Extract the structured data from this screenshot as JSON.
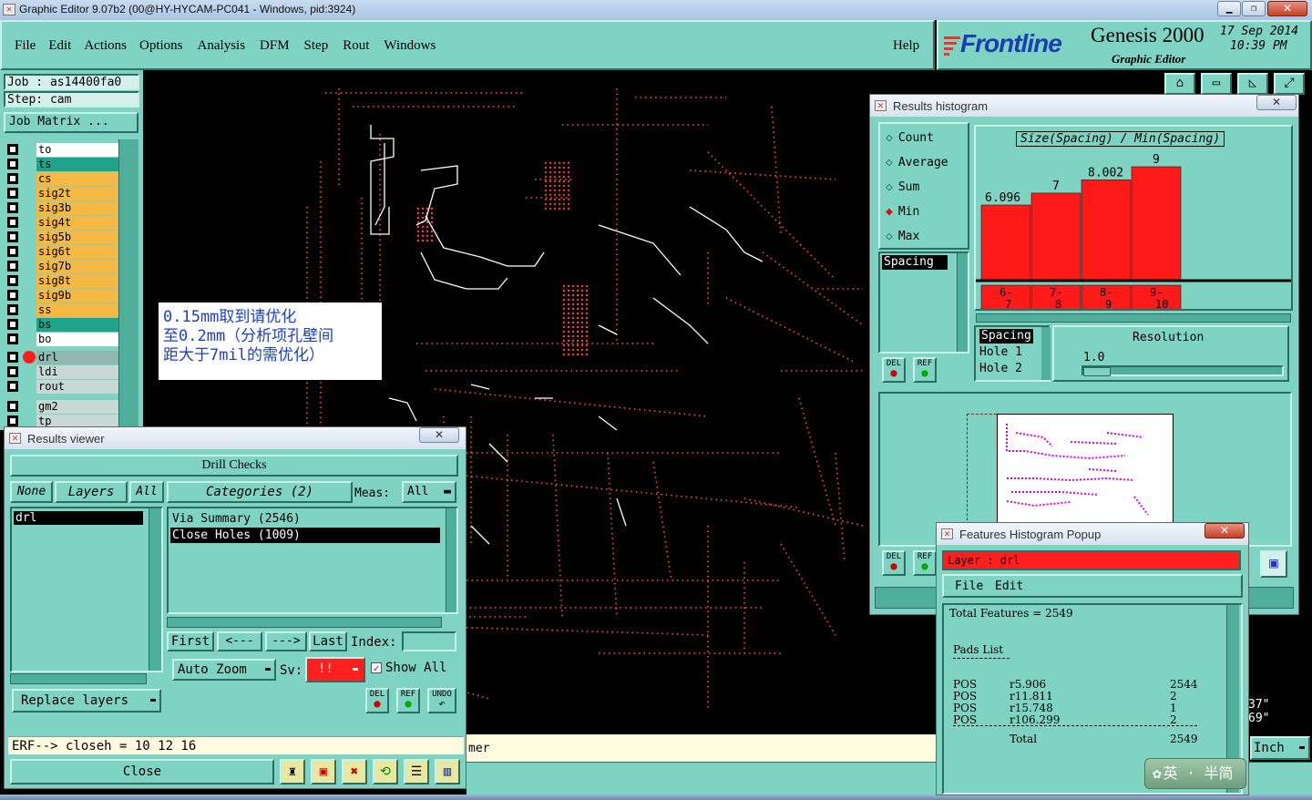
{
  "window": {
    "title": "Graphic Editor 9.07b2 (00@HY-HYCAM-PC041 - Windows, pid:3924)"
  },
  "menu": {
    "items": [
      "File",
      "Edit",
      "Actions",
      "Options",
      "Analysis",
      "DFM",
      "Step",
      "Rout",
      "Windows"
    ],
    "help": "Help"
  },
  "brand": {
    "logo": "Frontline",
    "product": "Genesis 2000",
    "subtitle": "Graphic Editor",
    "date": "17 Sep 2014",
    "time": "10:39 PM"
  },
  "job": {
    "job_label": "Job : as14400fa0",
    "step_label": "Step: cam",
    "matrix_button": "Job Matrix ..."
  },
  "layers": [
    {
      "name": "to",
      "bg": "#ffffff"
    },
    {
      "name": "ts",
      "bg": "#1fa38a"
    },
    {
      "name": "cs",
      "bg": "#f5b843"
    },
    {
      "name": "sig2t",
      "bg": "#f5b843"
    },
    {
      "name": "sig3b",
      "bg": "#f5b843"
    },
    {
      "name": "sig4t",
      "bg": "#f5b843"
    },
    {
      "name": "sig5b",
      "bg": "#f5b843"
    },
    {
      "name": "sig6t",
      "bg": "#f5b843"
    },
    {
      "name": "sig7b",
      "bg": "#f5b843"
    },
    {
      "name": "sig8t",
      "bg": "#f5b843"
    },
    {
      "name": "sig9b",
      "bg": "#f5b843"
    },
    {
      "name": "ss",
      "bg": "#f5b843"
    },
    {
      "name": "bs",
      "bg": "#1fa38a"
    },
    {
      "name": "bo",
      "bg": "#ffffff"
    }
  ],
  "layers2": [
    {
      "name": "drl",
      "bg": "#8fb8b0"
    },
    {
      "name": "ldi",
      "bg": "#c8d8d4"
    },
    {
      "name": "rout",
      "bg": "#c8d8d4"
    }
  ],
  "layers3": [
    {
      "name": "gm2",
      "bg": "#c8d8d4"
    },
    {
      "name": "tp",
      "bg": "#c8d8d4"
    }
  ],
  "note": {
    "line1": "0.15mm取到请优化",
    "line2": "至0.2mm（分析项孔壁间",
    "line3": "距大于7mil的需优化）"
  },
  "results_viewer": {
    "title": "Results viewer",
    "header": "Drill Checks",
    "none": "None",
    "layers": "Layers",
    "all": "All",
    "categories": "Categories (2)",
    "meas_label": "Meas:",
    "meas_value": "All",
    "layer_items": [
      "drl"
    ],
    "categories_list": [
      "Via Summary (2546)",
      "Close Holes (1009)"
    ],
    "nav": {
      "first": "First",
      "prev": "<---",
      "next": "--->",
      "last": "Last",
      "index_label": "Index:"
    },
    "auto_zoom": "Auto Zoom",
    "sv_label": "Sv:",
    "sv_value": "!!",
    "show_all": "Show All",
    "replace_layers": "Replace layers",
    "del": "DEL",
    "ref": "REF",
    "undo": "UNDO",
    "erf": "ERF--> closeh = 10 12 16",
    "close": "Close"
  },
  "histogram": {
    "title": "Results histogram",
    "modes": [
      "Count",
      "Average",
      "Sum",
      "Min",
      "Max"
    ],
    "selected_mode": "Min",
    "list_items": [
      "Spacing"
    ],
    "chart_title": "Size(Spacing) / Min(Spacing)",
    "param_items": [
      "Spacing",
      "Hole 1",
      "Hole 2"
    ],
    "resolution_label": "Resolution",
    "resolution_value": "1.0",
    "del": "DEL",
    "ref": "REF"
  },
  "chart_data": {
    "type": "bar",
    "title": "Size(Spacing) / Min(Spacing)",
    "categories": [
      "6-7",
      "7-8",
      "8-9",
      "9-10"
    ],
    "category_top": [
      "6-",
      "7-",
      "8-",
      "9-"
    ],
    "category_bottom": [
      "7",
      "8",
      "9",
      "10"
    ],
    "values": [
      6.096,
      7,
      8.002,
      9
    ],
    "value_labels": [
      "6.096",
      "7",
      "8.002",
      "9"
    ],
    "color": "#ff1a1a"
  },
  "features_popup": {
    "title": "Features Histogram Popup",
    "layer_label": "Layer : drl",
    "menu": [
      "File",
      "Edit"
    ],
    "total": "Total Features = 2549",
    "pads_header": "Pads List",
    "rows": [
      {
        "pol": "POS",
        "sym": "r5.906",
        "count": "2544"
      },
      {
        "pol": "POS",
        "sym": "r11.811",
        "count": "2"
      },
      {
        "pol": "POS",
        "sym": "r15.748",
        "count": "1"
      },
      {
        "pol": "POS",
        "sym": "r106.299",
        "count": "2"
      }
    ],
    "total_label": "Total",
    "total_value": "2549"
  },
  "statusbar": {
    "fragment": "mer",
    "units": "Inch",
    "coord1": "37\"",
    "coord2": "69\""
  },
  "ime": {
    "label": "英 · 半简"
  }
}
